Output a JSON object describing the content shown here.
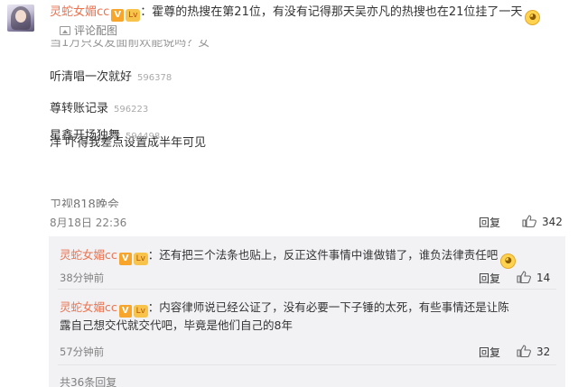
{
  "post": {
    "author": "灵蛇女媚cc",
    "vip_badge": "V",
    "level_badge": "Lv",
    "text": "：霍尊的热搜在第21位，有没有记得那天吴亦凡的热搜也在21位挂了一天",
    "emoji": "doge",
    "image_tag": "评论配图",
    "date": "8月18日 22:36",
    "reply_label": "回复",
    "like_count": "342"
  },
  "screenshot": {
    "rows": [
      {
        "text": "当1万只女友面前欢能说吗？女",
        "count": ""
      },
      {
        "text": "听清唱一次就好",
        "count": "596378"
      },
      {
        "text": "尊转账记录",
        "count": "596223"
      },
      {
        "text": "洋 吓得我差点设置成半年可见",
        "count": ""
      },
      {
        "text": "星鑫开场独舞",
        "count": "594498"
      },
      {
        "text": "卫视818晚会",
        "count": ""
      }
    ]
  },
  "replies": [
    {
      "author": "灵蛇女媚cc",
      "text_line1": "：还有把三个法条也贴上，反正这件事情中谁做错了，谁负法律责任吧",
      "text_line2": "",
      "emoji": "doge",
      "time": "38分钟前",
      "reply_label": "回复",
      "like_count": "14"
    },
    {
      "author": "灵蛇女媚cc",
      "text_line1": "：内容律师说已经公证了，没有必要一下子锤的太死，有些事情还是让陈",
      "text_line2": "露自己想交代就交代吧，毕竟是他们自己的8年",
      "emoji": "",
      "time": "57分钟前",
      "reply_label": "回复",
      "like_count": "32"
    }
  ],
  "more_replies": "共36条回复",
  "colors": {
    "username": "#eb7350",
    "meta": "#808080",
    "reply_bg": "#f2f2f5"
  }
}
